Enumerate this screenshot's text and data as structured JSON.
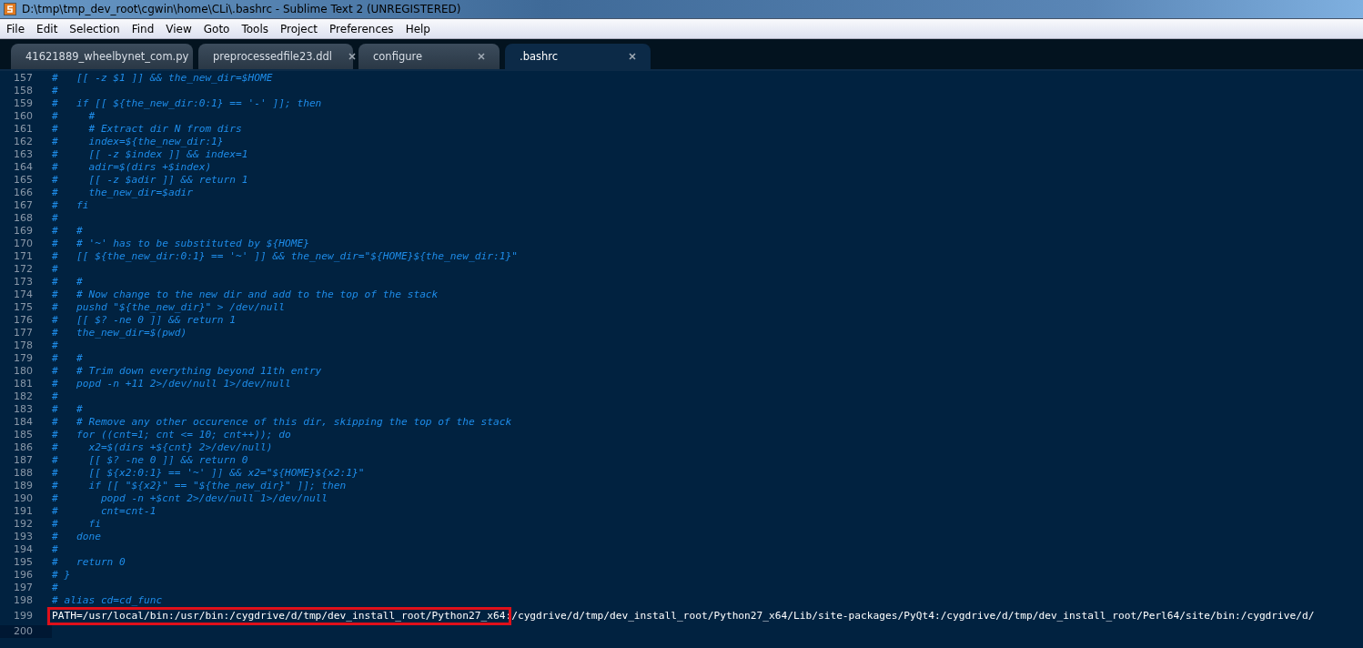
{
  "window": {
    "title": "D:\\tmp\\tmp_dev_root\\cgwin\\home\\CLi\\.bashrc - Sublime Text 2 (UNREGISTERED)"
  },
  "menu": [
    "File",
    "Edit",
    "Selection",
    "Find",
    "View",
    "Goto",
    "Tools",
    "Project",
    "Preferences",
    "Help"
  ],
  "tabs": [
    {
      "label": "41621889_wheelbynet_com.py",
      "selected": false
    },
    {
      "label": "preprocessedfile23.ddl",
      "selected": false
    },
    {
      "label": "configure",
      "selected": false
    },
    {
      "label": ".bashrc",
      "selected": true
    }
  ],
  "editor": {
    "lines": [
      {
        "number": "157",
        "text": "#   [[ -z $1 ]] && the_new_dir=$HOME",
        "kind": "comment"
      },
      {
        "number": "158",
        "text": "#",
        "kind": "comment"
      },
      {
        "number": "159",
        "text": "#   if [[ ${the_new_dir:0:1} == '-' ]]; then",
        "kind": "comment"
      },
      {
        "number": "160",
        "text": "#     #",
        "kind": "comment"
      },
      {
        "number": "161",
        "text": "#     # Extract dir N from dirs",
        "kind": "comment"
      },
      {
        "number": "162",
        "text": "#     index=${the_new_dir:1}",
        "kind": "comment"
      },
      {
        "number": "163",
        "text": "#     [[ -z $index ]] && index=1",
        "kind": "comment"
      },
      {
        "number": "164",
        "text": "#     adir=$(dirs +$index)",
        "kind": "comment"
      },
      {
        "number": "165",
        "text": "#     [[ -z $adir ]] && return 1",
        "kind": "comment"
      },
      {
        "number": "166",
        "text": "#     the_new_dir=$adir",
        "kind": "comment"
      },
      {
        "number": "167",
        "text": "#   fi",
        "kind": "comment"
      },
      {
        "number": "168",
        "text": "#",
        "kind": "comment"
      },
      {
        "number": "169",
        "text": "#   #",
        "kind": "comment"
      },
      {
        "number": "170",
        "text": "#   # '~' has to be substituted by ${HOME}",
        "kind": "comment"
      },
      {
        "number": "171",
        "text": "#   [[ ${the_new_dir:0:1} == '~' ]] && the_new_dir=\"${HOME}${the_new_dir:1}\"",
        "kind": "comment"
      },
      {
        "number": "172",
        "text": "#",
        "kind": "comment"
      },
      {
        "number": "173",
        "text": "#   #",
        "kind": "comment"
      },
      {
        "number": "174",
        "text": "#   # Now change to the new dir and add to the top of the stack",
        "kind": "comment"
      },
      {
        "number": "175",
        "text": "#   pushd \"${the_new_dir}\" > /dev/null",
        "kind": "comment"
      },
      {
        "number": "176",
        "text": "#   [[ $? -ne 0 ]] && return 1",
        "kind": "comment"
      },
      {
        "number": "177",
        "text": "#   the_new_dir=$(pwd)",
        "kind": "comment"
      },
      {
        "number": "178",
        "text": "#",
        "kind": "comment"
      },
      {
        "number": "179",
        "text": "#   #",
        "kind": "comment"
      },
      {
        "number": "180",
        "text": "#   # Trim down everything beyond 11th entry",
        "kind": "comment"
      },
      {
        "number": "181",
        "text": "#   popd -n +11 2>/dev/null 1>/dev/null",
        "kind": "comment"
      },
      {
        "number": "182",
        "text": "#",
        "kind": "comment"
      },
      {
        "number": "183",
        "text": "#   #",
        "kind": "comment"
      },
      {
        "number": "184",
        "text": "#   # Remove any other occurence of this dir, skipping the top of the stack",
        "kind": "comment"
      },
      {
        "number": "185",
        "text": "#   for ((cnt=1; cnt <= 10; cnt++)); do",
        "kind": "comment"
      },
      {
        "number": "186",
        "text": "#     x2=$(dirs +${cnt} 2>/dev/null)",
        "kind": "comment"
      },
      {
        "number": "187",
        "text": "#     [[ $? -ne 0 ]] && return 0",
        "kind": "comment"
      },
      {
        "number": "188",
        "text": "#     [[ ${x2:0:1} == '~' ]] && x2=\"${HOME}${x2:1}\"",
        "kind": "comment"
      },
      {
        "number": "189",
        "text": "#     if [[ \"${x2}\" == \"${the_new_dir}\" ]]; then",
        "kind": "comment"
      },
      {
        "number": "190",
        "text": "#       popd -n +$cnt 2>/dev/null 1>/dev/null",
        "kind": "comment"
      },
      {
        "number": "191",
        "text": "#       cnt=cnt-1",
        "kind": "comment"
      },
      {
        "number": "192",
        "text": "#     fi",
        "kind": "comment"
      },
      {
        "number": "193",
        "text": "#   done",
        "kind": "comment"
      },
      {
        "number": "194",
        "text": "#",
        "kind": "comment"
      },
      {
        "number": "195",
        "text": "#   return 0",
        "kind": "comment"
      },
      {
        "number": "196",
        "text": "# }",
        "kind": "comment"
      },
      {
        "number": "197",
        "text": "#",
        "kind": "comment"
      },
      {
        "number": "198",
        "text": "# alias cd=cd_func",
        "kind": "comment"
      },
      {
        "number": "199",
        "text": "PATH=/usr/local/bin:/usr/bin:/cygdrive/d/tmp/dev_install_root/Python27_x64:/cygdrive/d/tmp/dev_install_root/Python27_x64/Lib/site-packages/PyQt4:/cygdrive/d/tmp/dev_install_root/Perl64/site/bin:/cygdrive/d/",
        "kind": "plain",
        "highlighted": true
      },
      {
        "number": "200",
        "current": true
      }
    ]
  }
}
